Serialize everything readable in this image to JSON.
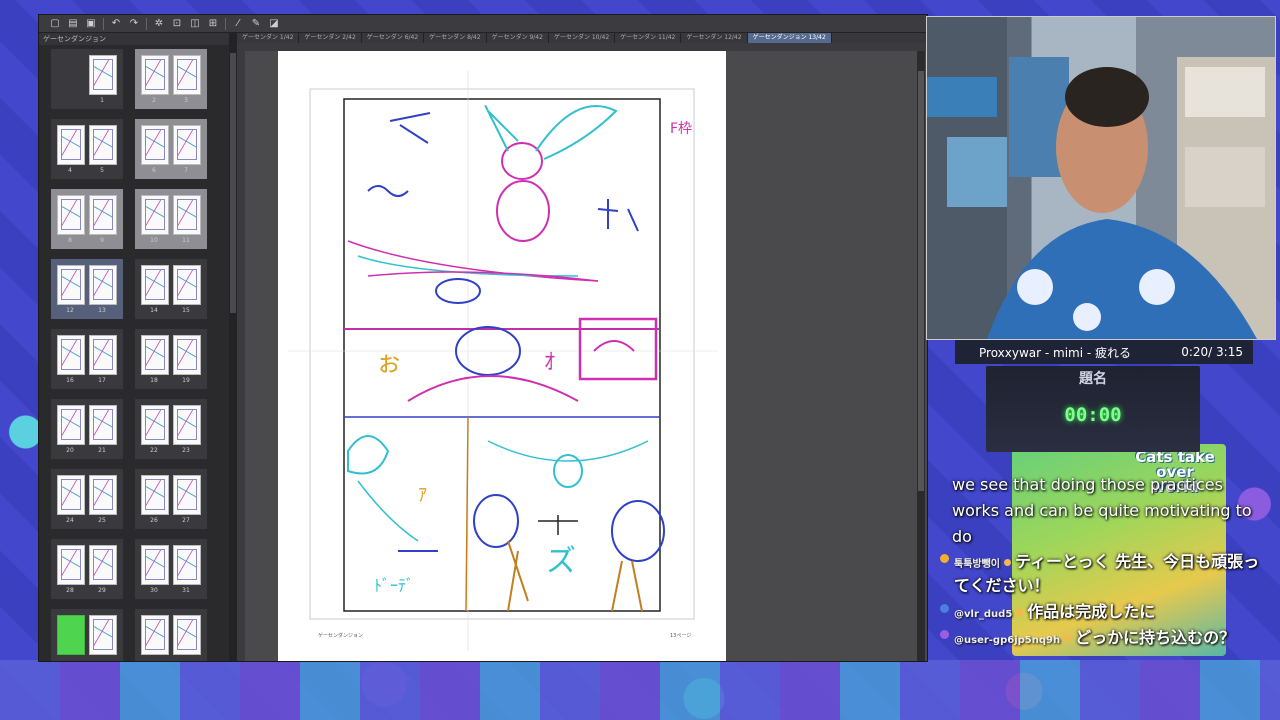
{
  "app": {
    "panel_title": "ゲーセンダンジョン",
    "doc_tabs": [
      "ゲーセンダン 1/42",
      "ゲーセンダン 2/42",
      "ゲーセンダン 6/42",
      "ゲーセンダン 8/42",
      "ゲーセンダン 9/42",
      "ゲーセンダン 10/42",
      "ゲーセンダン 11/42",
      "ゲーセンダン 12/42",
      "ゲーセンダンジョン 13/42"
    ],
    "page_numbers": [
      "1",
      "2",
      "3",
      "4",
      "5",
      "6",
      "7",
      "8",
      "9",
      "10",
      "11",
      "12",
      "13",
      "14",
      "15",
      "16",
      "17",
      "18",
      "19",
      "20",
      "21",
      "22",
      "23",
      "24",
      "25",
      "26",
      "27",
      "28",
      "29",
      "30",
      "31"
    ],
    "page_footer_left": "ゲーセンダンジョン",
    "page_footer_right": "13ページ",
    "margin_note": "F枠"
  },
  "music": {
    "title": "Proxxywar - mimi - 疲れる",
    "time": "0:20/ 3:15"
  },
  "timer": {
    "title": "題名",
    "clock": "00:00"
  },
  "poster": {
    "text": "Cats take over world"
  },
  "caption": "we see that doing those practices works and can be quite motivating to do",
  "chat": [
    {
      "user": "툭툭방뺑이",
      "text": "ティーとっく 先生、今日も頑張ってください！",
      "color": "#f0b030"
    },
    {
      "user": "@vlr_dud5",
      "text": "作品は完成したに",
      "color": "#4a7fe0"
    },
    {
      "user": "@user-gp6jp5nq9h",
      "text": "どっかに持ち込むの？",
      "color": "#9a5fe0"
    }
  ],
  "colors": {
    "accent_blue": "#566a90",
    "timer_green": "#7dff8a",
    "sketch_magenta": "#d030b0",
    "sketch_cyan": "#30c0d0",
    "sketch_blue": "#3040c8"
  },
  "icons": [
    "new-file-icon",
    "open-icon",
    "save-icon",
    "undo-icon",
    "redo-icon",
    "settings-icon",
    "transform-icon",
    "pen-icon",
    "brush-icon"
  ]
}
